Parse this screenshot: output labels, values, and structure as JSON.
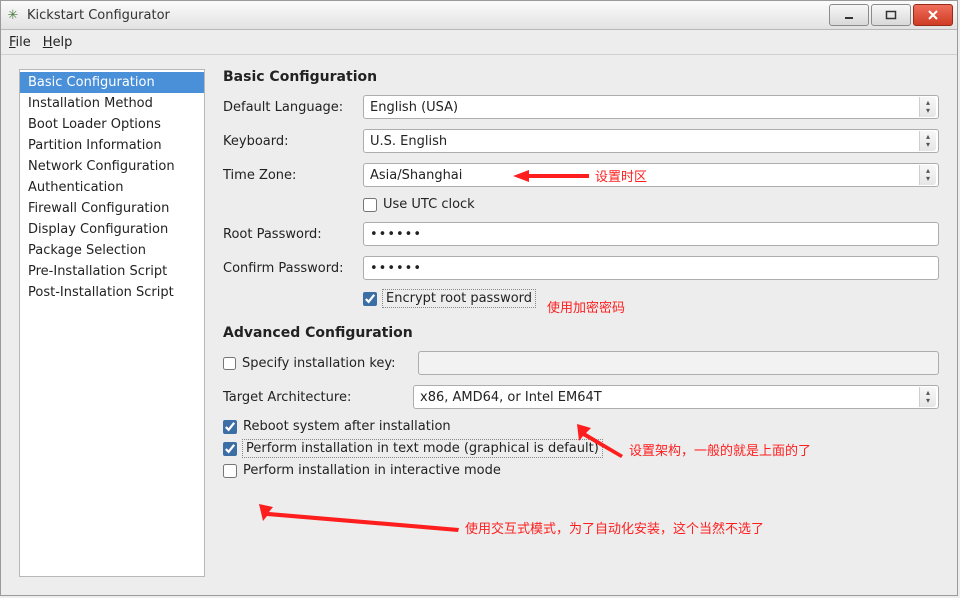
{
  "window": {
    "title": "Kickstart Configurator"
  },
  "menu": {
    "file": "File",
    "file_accel": "F",
    "help": "Help",
    "help_accel": "H"
  },
  "sidebar": {
    "items": [
      "Basic Configuration",
      "Installation Method",
      "Boot Loader Options",
      "Partition Information",
      "Network Configuration",
      "Authentication",
      "Firewall Configuration",
      "Display Configuration",
      "Package Selection",
      "Pre-Installation Script",
      "Post-Installation Script"
    ],
    "selected_index": 0
  },
  "basic": {
    "heading": "Basic Configuration",
    "default_language_label": "Default Language:",
    "default_language_value": "English (USA)",
    "keyboard_label": "Keyboard:",
    "keyboard_value": "U.S. English",
    "timezone_label": "Time Zone:",
    "timezone_value": "Asia/Shanghai",
    "use_utc_label": "Use UTC clock",
    "use_utc_checked": false,
    "root_password_label": "Root Password:",
    "root_password_value": "••••••",
    "confirm_password_label": "Confirm Password:",
    "confirm_password_value": "••••••",
    "encrypt_label": "Encrypt root password",
    "encrypt_checked": true
  },
  "advanced": {
    "heading": "Advanced Configuration",
    "spec_key_label": "Specify installation key:",
    "spec_key_checked": false,
    "spec_key_value": "",
    "target_arch_label": "Target Architecture:",
    "target_arch_value": "x86, AMD64, or Intel EM64T",
    "reboot_label": "Reboot system after installation",
    "reboot_checked": true,
    "textmode_label": "Perform installation in text mode (graphical is default)",
    "textmode_checked": true,
    "interactive_label": "Perform installation in interactive mode",
    "interactive_checked": false
  },
  "annotations": {
    "timezone": "设置时区",
    "encrypt": "使用加密密码",
    "arch": "设置架构，一般的就是上面的了",
    "interactive": "使用交互式模式，为了自动化安装，这个当然不选了"
  }
}
